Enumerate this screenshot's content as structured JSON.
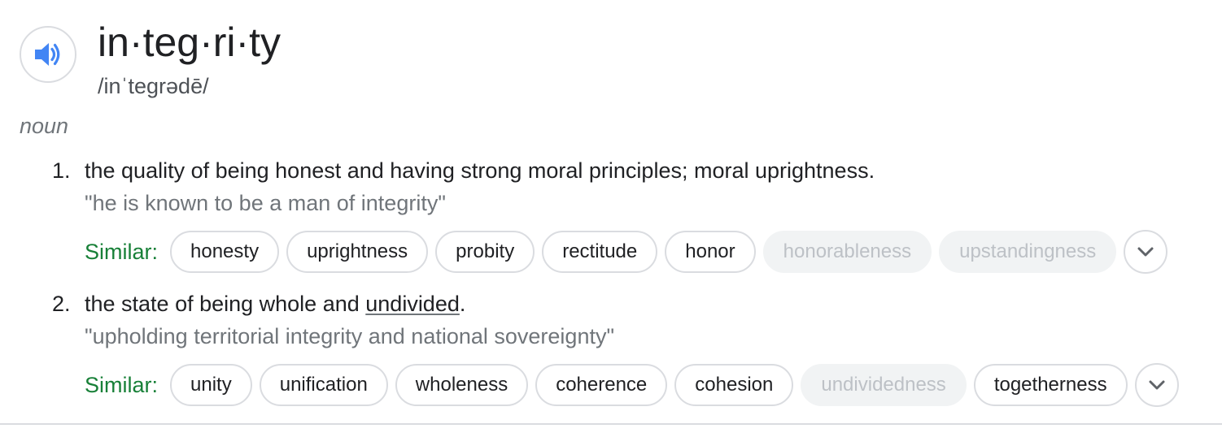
{
  "entry": {
    "headword": "in·teg·ri·ty",
    "pronunciation": "/inˈtegrədē/",
    "part_of_speech": "noun",
    "speaker_icon": "volume-up-icon"
  },
  "senses": [
    {
      "number": "1.",
      "definition": "the quality of being honest and having strong moral principles; moral uprightness.",
      "example": "\"he is known to be a man of integrity\"",
      "similar_label": "Similar:",
      "similar": [
        {
          "label": "honesty",
          "muted": false
        },
        {
          "label": "uprightness",
          "muted": false
        },
        {
          "label": "probity",
          "muted": false
        },
        {
          "label": "rectitude",
          "muted": false
        },
        {
          "label": "honor",
          "muted": false
        },
        {
          "label": "honorableness",
          "muted": true
        },
        {
          "label": "upstandingness",
          "muted": true
        }
      ],
      "expand_icon": "chevron-down-icon"
    },
    {
      "number": "2.",
      "definition_before": "the state of being whole and ",
      "definition_link": "undivided",
      "definition_after": ".",
      "example": "\"upholding territorial integrity and national sovereignty\"",
      "similar_label": "Similar:",
      "similar": [
        {
          "label": "unity",
          "muted": false
        },
        {
          "label": "unification",
          "muted": false
        },
        {
          "label": "wholeness",
          "muted": false
        },
        {
          "label": "coherence",
          "muted": false
        },
        {
          "label": "cohesion",
          "muted": false
        },
        {
          "label": "undividedness",
          "muted": true
        },
        {
          "label": "togetherness",
          "muted": false
        }
      ],
      "expand_icon": "chevron-down-icon"
    }
  ],
  "colors": {
    "speaker_blue": "#4285f4",
    "similar_green": "#188038",
    "chip_border": "#dadce0",
    "muted_chip_bg": "#f1f3f4",
    "muted_chip_text": "#bdc1c6"
  }
}
